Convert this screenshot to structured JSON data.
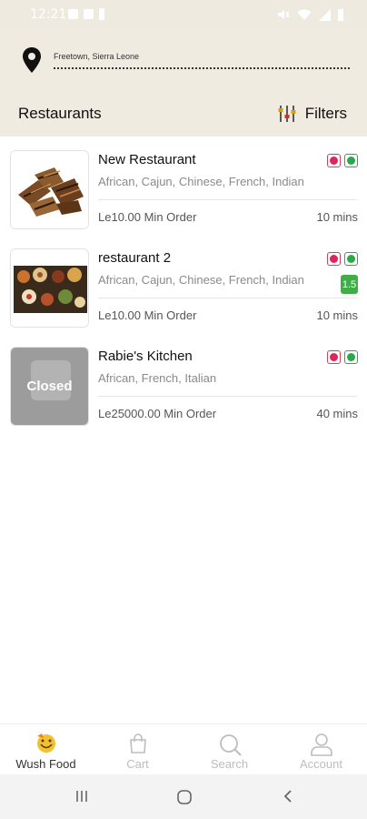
{
  "status_bar": {
    "time": "12:21"
  },
  "header": {
    "location": "Freetown, Sierra Leone",
    "section_title": "Restaurants",
    "filters_label": "Filters"
  },
  "restaurants": [
    {
      "name": "New Restaurant",
      "cuisines": "African, Cajun, Chinese, French, Indian",
      "min_order": "Le10.00 Min Order",
      "time": "10 mins",
      "rating": "",
      "closed": false
    },
    {
      "name": "restaurant 2",
      "cuisines": "African, Cajun, Chinese, French, Indian",
      "min_order": "Le10.00 Min Order",
      "time": "10 mins",
      "rating": "1.5",
      "closed": false
    },
    {
      "name": "Rabie's Kitchen",
      "cuisines": "African, French, Italian",
      "min_order": "Le25000.00 Min Order",
      "time": "40 mins",
      "rating": "",
      "closed": true,
      "closed_label": "Closed"
    }
  ],
  "bottom_nav": {
    "items": [
      {
        "label": "Wush Food",
        "icon": "wush-food-icon",
        "active": true
      },
      {
        "label": "Cart",
        "icon": "cart-icon",
        "active": false
      },
      {
        "label": "Search",
        "icon": "search-icon",
        "active": false
      },
      {
        "label": "Account",
        "icon": "account-icon",
        "active": false
      }
    ]
  },
  "colors": {
    "header_bg": "#efebe1",
    "rating_green": "#3fae46",
    "non_veg_red": "#e0245e",
    "veg_green": "#2aa94a"
  }
}
